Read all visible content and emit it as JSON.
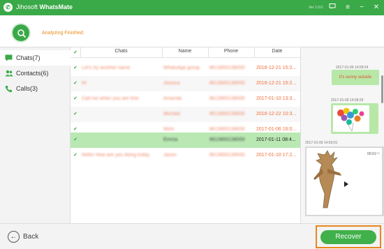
{
  "app": {
    "title_prefix": "Jihosoft ",
    "title_strong": "WhatsMate",
    "version": "Ver 1.0.0",
    "logo_icon": "whatsapp-icon"
  },
  "window_controls": [
    "chat-icon",
    "menu-icon",
    "minimize-icon",
    "close-icon"
  ],
  "status": {
    "text": "Analyzing Finished.",
    "icon": "search-icon"
  },
  "sidebar": {
    "items": [
      {
        "label": "Chats(7)",
        "icon": "chat-icon"
      },
      {
        "label": "Contacts(6)",
        "icon": "contacts-icon"
      },
      {
        "label": "Calls(3)",
        "icon": "phone-icon"
      }
    ]
  },
  "table": {
    "headers": {
      "chats": "Chats",
      "name": "Name",
      "phone": "Phone",
      "date": "Date"
    },
    "rows": [
      {
        "chat": "Let's try another name",
        "name": "WhatsApp group",
        "phone": "8613800138000",
        "date": "2016-12-21 15:2..."
      },
      {
        "chat": "Hi",
        "name": "Jessica",
        "phone": "8613800138000",
        "date": "2016-12-21 15:2..."
      },
      {
        "chat": "Call me when you are free",
        "name": "Amanda",
        "phone": "8613800138000",
        "date": "2017-01-10 13:3..."
      },
      {
        "chat": "",
        "name": "Michael",
        "phone": "8613800138000",
        "date": "2016-12-22 10:3..."
      },
      {
        "chat": "",
        "name": "Mom",
        "phone": "8613800138000",
        "date": "2017-01-06 16:0..."
      },
      {
        "chat": "",
        "name": "Emma",
        "phone": "8613800138000",
        "date": "2017-01-11 08:4..."
      },
      {
        "chat": "Hello! How are you doing today",
        "name": "Jason",
        "phone": "8613800138000",
        "date": "2017-01-10 17:2..."
      }
    ],
    "selected_row": 5
  },
  "preview": {
    "messages": [
      {
        "time": "2017-01-09 14:58:24",
        "text": "It's sunny outside"
      },
      {
        "time": "2017-01-09 14:58:29",
        "text": ""
      },
      {
        "time": "2017-01-09 14:59:01",
        "duration": "00:01"
      }
    ]
  },
  "footer": {
    "back_label": "Back",
    "recover_label": "Recover"
  },
  "colors": {
    "brand": "#3aa948",
    "status_text": "#e88a18",
    "date_text": "#f06d3b",
    "selected_row": "#b9e8b3",
    "highlight_frame": "#e8871c"
  }
}
